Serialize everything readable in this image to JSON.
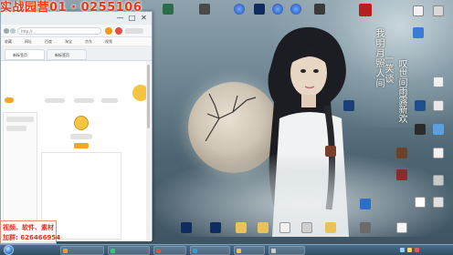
{
  "watermark": {
    "top_text": "实战园营01 · 0255106",
    "box_line1": "视频、软件、素材",
    "box_line2": "加群: 626466954"
  },
  "wallpaper": {
    "calligraphy_left": "我明月照人间",
    "calligraphy_mid": "一笑谈",
    "calligraphy_right": "叹世间雨露新欢"
  },
  "browser": {
    "url": "http://...",
    "bookmarks": [
      "收藏",
      "网址",
      "百度",
      "淘宝",
      "京东",
      "视频"
    ],
    "tabs": [
      "新标签页",
      "新标签页"
    ],
    "buttons": {
      "minimize": "—",
      "maximize": "□",
      "close": "✕"
    }
  },
  "desktop_icons": [
    {
      "name": "ps-icon",
      "label": "Ps"
    },
    {
      "name": "pr-icon",
      "label": "Pr"
    },
    {
      "name": "qq-icon",
      "label": "QQ"
    },
    {
      "name": "recycle-icon",
      "label": ""
    },
    {
      "name": "folder-icon",
      "label": ""
    },
    {
      "name": "word-icon",
      "label": ""
    }
  ],
  "taskbar": {
    "items": [
      "",
      "",
      "",
      "",
      "",
      ""
    ],
    "clock_time": "",
    "clock_date": ""
  },
  "colors": {
    "accent_orange": "#f5a623",
    "watermark_red": "#e53a1a",
    "taskbar": "#2f4d66"
  }
}
